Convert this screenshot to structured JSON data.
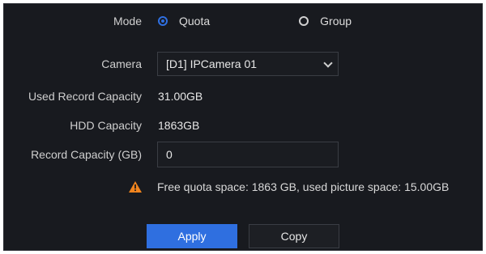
{
  "mode": {
    "label": "Mode",
    "options": [
      {
        "label": "Quota",
        "selected": true
      },
      {
        "label": "Group",
        "selected": false
      }
    ]
  },
  "camera": {
    "label": "Camera",
    "selected": "[D1] IPCamera 01"
  },
  "used_record_capacity": {
    "label": "Used Record Capacity",
    "value": "31.00GB"
  },
  "hdd_capacity": {
    "label": "HDD Capacity",
    "value": "1863GB"
  },
  "record_capacity": {
    "label": "Record Capacity (GB)",
    "value": "0"
  },
  "warning": {
    "icon": "warning-icon",
    "text": "Free quota space: 1863 GB, used picture space: 15.00GB"
  },
  "buttons": {
    "apply": "Apply",
    "copy": "Copy"
  },
  "colors": {
    "background": "#181a1f",
    "accent": "#2f6fe0",
    "warning": "#f0841e"
  }
}
